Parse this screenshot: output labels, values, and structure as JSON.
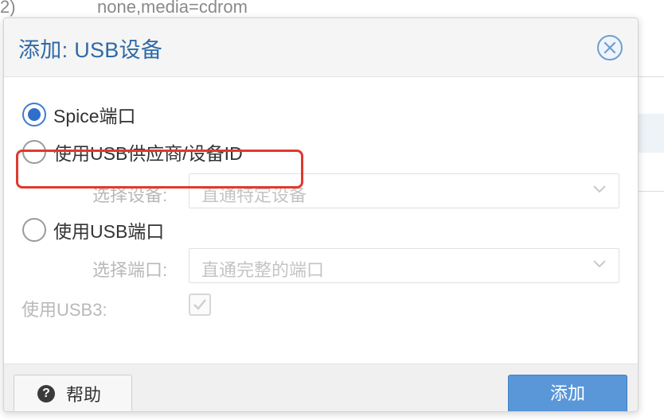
{
  "background": {
    "row_number": "2)",
    "row_text": "none,media=cdrom"
  },
  "dialog": {
    "title": "添加: USB设备",
    "options": {
      "spice_label": "Spice端口",
      "vendor_label": "使用USB供应商/设备ID",
      "port_label": "使用USB端口"
    },
    "select_device": {
      "label": "选择设备:",
      "value": "直通特定设备"
    },
    "select_port": {
      "label": "选择端口:",
      "value": "直通完整的端口"
    },
    "usb3": {
      "label": "使用USB3:",
      "checked": true
    },
    "footer": {
      "help_label": "帮助",
      "help_icon": "?",
      "add_label": "添加"
    }
  },
  "colors": {
    "title": "#2f6aa6",
    "primary_button": "#5a97d8",
    "highlight": "#e0392e",
    "radio_selected": "#2f6fc9"
  },
  "icons": {
    "close": "close-circle-icon",
    "chevron": "chevron-down-icon",
    "help": "question-circle-icon",
    "check": "checkmark-icon"
  }
}
